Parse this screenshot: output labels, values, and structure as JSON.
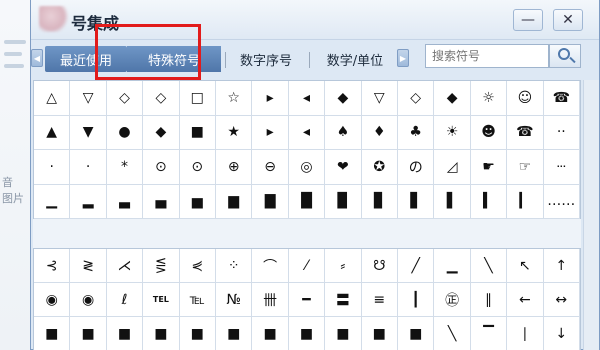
{
  "window": {
    "title": "号集成",
    "minimize_glyph": "—",
    "close_glyph": "✕"
  },
  "background": {
    "side_text": [
      "音",
      "图片"
    ]
  },
  "tabs": {
    "recent": "最近使用",
    "special": "特殊符号",
    "numbers": "数字序号",
    "math": "数学/单位"
  },
  "search": {
    "placeholder": "搜索符号"
  },
  "colors": {
    "accent_tab": "#5a82b4",
    "highlight": "#e21b1b"
  },
  "grid_top": [
    [
      "△",
      "▽",
      "◇",
      "◇",
      "□",
      "☆",
      "▸",
      "◂",
      "◆",
      "▽",
      "◇",
      "◆",
      "☼",
      "☺",
      "☎",
      "·"
    ],
    [
      "▲",
      "▼",
      "●",
      "◆",
      "■",
      "★",
      "▸",
      "◂",
      "♠",
      "♦",
      "♣",
      "☀",
      "☻",
      "☎",
      "··"
    ],
    [
      "·",
      "·",
      "*",
      "⊙",
      "⊙",
      "⊕",
      "⊖",
      "◎",
      "❤",
      "✪",
      "の",
      "◿",
      "☛",
      "☞",
      "···"
    ],
    [
      "▁",
      "▂",
      "▃",
      "▄",
      "▅",
      "▆",
      "▇",
      "█",
      "▉",
      "▊",
      "▋",
      "▌",
      "▍",
      "▎",
      "……"
    ]
  ],
  "grid_bottom": [
    [
      "⊰",
      "≷",
      "⋌",
      "⋚",
      "⋞",
      "⁘",
      "⌒",
      "⁄",
      "⸗",
      "☋",
      "╱",
      "▁",
      "╲",
      "↖",
      "↑",
      "↗"
    ],
    [
      "◉",
      "◉",
      "ℓ",
      "TEL",
      "℡",
      "№",
      "卌",
      "━",
      "〓",
      "≡",
      "┃",
      "㊣",
      "∥",
      "←",
      "↔",
      "→"
    ],
    [
      "■",
      "■",
      "■",
      "■",
      "■",
      "■",
      "■",
      "■",
      "■",
      "■",
      "■",
      "╲",
      "▔",
      "∣",
      "↓",
      "↘"
    ]
  ]
}
